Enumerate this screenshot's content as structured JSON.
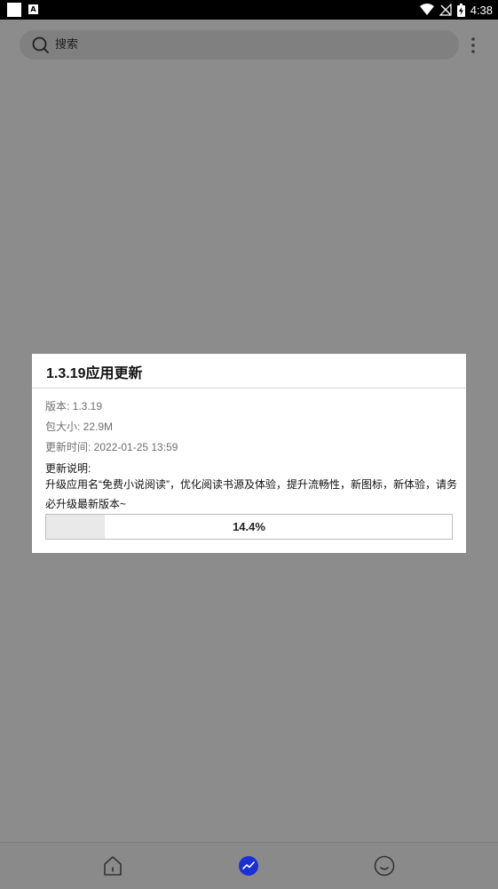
{
  "status_bar": {
    "time": "4:38",
    "icons": [
      "square-icon",
      "a-badge-icon",
      "wifi-icon",
      "no-signal-icon",
      "battery-charging-icon"
    ]
  },
  "search": {
    "placeholder": "搜索"
  },
  "dialog": {
    "title": "1.3.19应用更新",
    "version": "版本: 1.3.19",
    "size": "包大小: 22.9M",
    "update_time": "更新时间: 2022-01-25 13:59",
    "notes_label": "更新说明:",
    "notes_body": "升级应用名“免费小说阅读”，优化阅读书源及体验，提升流畅性，新图标，新体验，请务必升级最新版本~",
    "progress_text": "14.4%",
    "progress_value": 0.144
  },
  "bottom_nav": {
    "items": [
      {
        "name": "home",
        "icon": "home-icon"
      },
      {
        "name": "discover",
        "icon": "trend-icon"
      },
      {
        "name": "me",
        "icon": "smile-icon"
      }
    ],
    "active_color": "#1a2fd6"
  }
}
